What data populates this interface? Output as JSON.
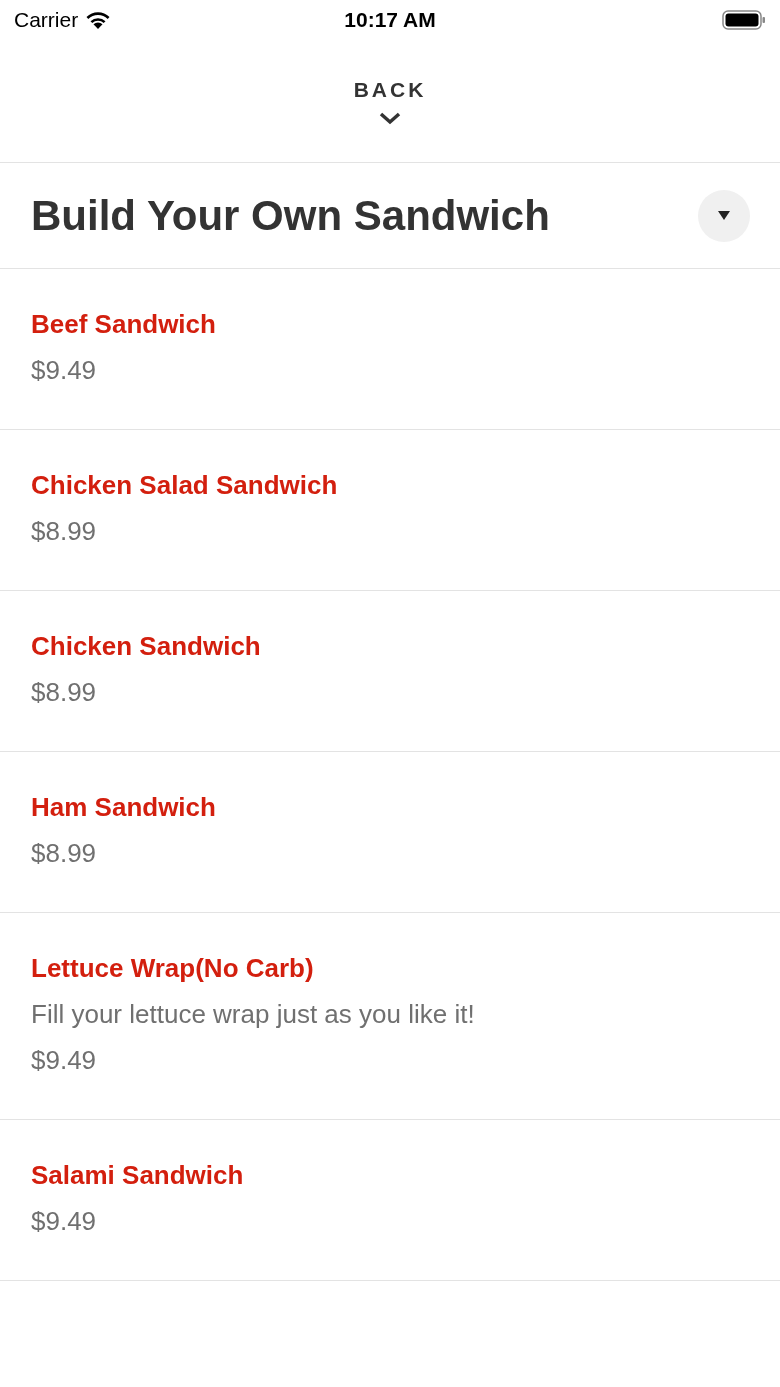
{
  "status_bar": {
    "carrier": "Carrier",
    "time": "10:17 AM"
  },
  "back": {
    "label": "BACK"
  },
  "category": {
    "title": "Build Your Own Sandwich",
    "expanded": true
  },
  "items": [
    {
      "name": "Beef Sandwich",
      "price": "$9.49"
    },
    {
      "name": "Chicken Salad Sandwich",
      "price": "$8.99"
    },
    {
      "name": "Chicken Sandwich",
      "price": "$8.99"
    },
    {
      "name": "Ham Sandwich",
      "price": "$8.99"
    },
    {
      "name": "Lettuce Wrap(No Carb)",
      "description": "Fill your lettuce wrap just as you like it!",
      "price": "$9.49"
    },
    {
      "name": "Salami Sandwich",
      "price": "$9.49"
    }
  ]
}
